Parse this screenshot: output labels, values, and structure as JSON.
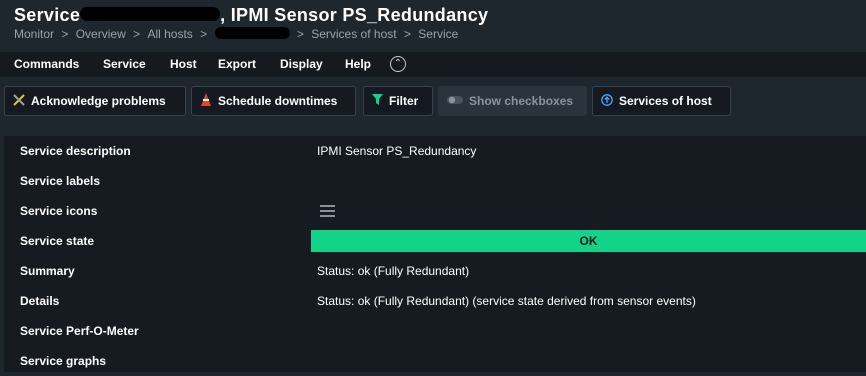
{
  "header": {
    "title_prefix": "Service",
    "title_suffix": ", IPMI Sensor PS_Redundancy",
    "breadcrumb": [
      "Monitor",
      "Overview",
      "All hosts",
      "Services of host",
      "Service"
    ],
    "breadcrumb_sep": ">"
  },
  "menu": {
    "items": [
      "Commands",
      "Service",
      "Host",
      "Export",
      "Display",
      "Help"
    ],
    "toggle_icon": "chevron-up-circle-icon"
  },
  "toolbar": {
    "acknowledge_label": "Acknowledge problems",
    "schedule_label": "Schedule downtimes",
    "filter_label": "Filter",
    "checkboxes_label": "Show checkboxes",
    "services_of_host_label": "Services of host"
  },
  "details": {
    "rows": [
      {
        "label": "Service description",
        "value": "IPMI Sensor PS_Redundancy"
      },
      {
        "label": "Service labels",
        "value": ""
      },
      {
        "label": "Service icons",
        "value": ""
      },
      {
        "label": "Service state",
        "value": "OK"
      },
      {
        "label": "Summary",
        "value": "Status: ok (Fully Redundant)"
      },
      {
        "label": "Details",
        "value": "Status: ok (Fully Redundant) (service state derived from sensor events)"
      },
      {
        "label": "Service Perf-O-Meter",
        "value": ""
      },
      {
        "label": "Service graphs",
        "value": ""
      }
    ]
  },
  "colors": {
    "state_ok": "#13d389",
    "background": "#1e262e",
    "table_bg": "#151b21"
  }
}
